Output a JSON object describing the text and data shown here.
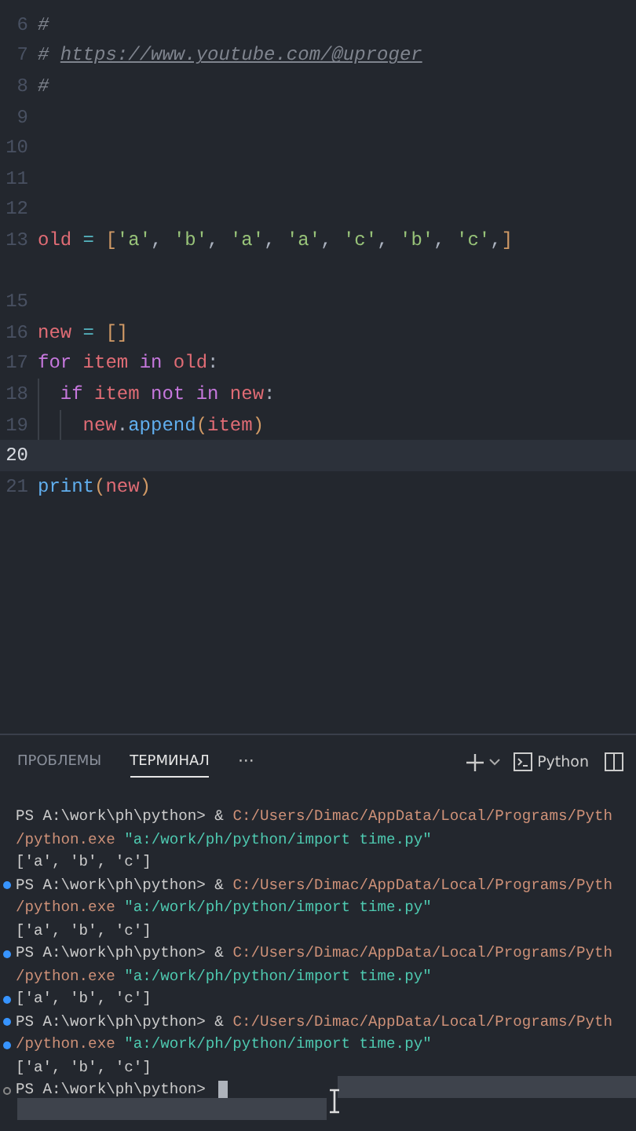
{
  "editor": {
    "lines": [
      {
        "number": "6",
        "current": false,
        "tokens": [
          {
            "kind": "comment",
            "text": "#"
          }
        ]
      },
      {
        "number": "7",
        "current": false,
        "tokens": [
          {
            "kind": "comment",
            "text": "# "
          },
          {
            "kind": "link",
            "text": "https://www.youtube.com/@uproger"
          }
        ]
      },
      {
        "number": "8",
        "current": false,
        "tokens": [
          {
            "kind": "comment",
            "text": "#"
          }
        ]
      },
      {
        "number": "9",
        "current": false
      },
      {
        "number": "10",
        "current": false
      },
      {
        "number": "11",
        "current": false
      },
      {
        "number": "12",
        "current": false
      },
      {
        "number": "13",
        "current": false,
        "tokens": [
          {
            "kind": "var",
            "text": "old"
          },
          {
            "kind": "op",
            "text": " = "
          },
          {
            "kind": "bracket",
            "text": "["
          },
          {
            "kind": "string",
            "text": "'a'"
          },
          {
            "kind": "punct",
            "text": ", "
          },
          {
            "kind": "string",
            "text": "'b'"
          },
          {
            "kind": "punct",
            "text": ", "
          },
          {
            "kind": "string",
            "text": "'a'"
          },
          {
            "kind": "punct",
            "text": ", "
          },
          {
            "kind": "string",
            "text": "'a'"
          },
          {
            "kind": "punct",
            "text": ", "
          },
          {
            "kind": "string",
            "text": "'c'"
          },
          {
            "kind": "punct",
            "text": ", "
          },
          {
            "kind": "string",
            "text": "'b'"
          },
          {
            "kind": "punct",
            "text": ", "
          },
          {
            "kind": "string",
            "text": "'c'"
          },
          {
            "kind": "punct",
            "text": ","
          },
          {
            "kind": "bracket",
            "text": "]"
          }
        ]
      },
      {
        "number": "15",
        "current": false,
        "gap_before": true
      },
      {
        "number": "16",
        "current": false,
        "tokens": [
          {
            "kind": "var",
            "text": "new"
          },
          {
            "kind": "op",
            "text": " = "
          },
          {
            "kind": "bracket",
            "text": "[]"
          }
        ]
      },
      {
        "number": "17",
        "current": false,
        "tokens": [
          {
            "kind": "keyword",
            "text": "for"
          },
          {
            "kind": "var",
            "text": " item "
          },
          {
            "kind": "keyword",
            "text": "in"
          },
          {
            "kind": "var",
            "text": " old"
          },
          {
            "kind": "punct",
            "text": ":"
          }
        ]
      },
      {
        "number": "18",
        "current": false,
        "tokens": [
          {
            "kind": "guide"
          },
          {
            "kind": "keyword",
            "text": "if"
          },
          {
            "kind": "var",
            "text": " item "
          },
          {
            "kind": "keyword",
            "text": "not in"
          },
          {
            "kind": "var",
            "text": " new"
          },
          {
            "kind": "punct",
            "text": ":"
          }
        ]
      },
      {
        "number": "19",
        "current": false,
        "tokens": [
          {
            "kind": "guide"
          },
          {
            "kind": "guide"
          },
          {
            "kind": "var",
            "text": "new"
          },
          {
            "kind": "punct",
            "text": "."
          },
          {
            "kind": "func",
            "text": "append"
          },
          {
            "kind": "bracket",
            "text": "("
          },
          {
            "kind": "var",
            "text": "item"
          },
          {
            "kind": "bracket",
            "text": ")"
          }
        ]
      },
      {
        "number": "20",
        "current": true
      },
      {
        "number": "21",
        "current": false,
        "tokens": [
          {
            "kind": "func",
            "text": "print"
          },
          {
            "kind": "bracket",
            "text": "("
          },
          {
            "kind": "var",
            "text": "new"
          },
          {
            "kind": "bracket",
            "text": ")"
          }
        ]
      }
    ]
  },
  "panel": {
    "tabs": [
      {
        "label": "ПРОБЛЕМЫ",
        "selected": false
      },
      {
        "label": "ТЕРМИНАЛ",
        "selected": true
      }
    ],
    "more": "···",
    "shell": "Python",
    "terminal": [
      {
        "segments": [
          {
            "kind": "plain",
            "text": "PS A:\\work\\ph\\python> & "
          },
          {
            "kind": "path",
            "text": "C:/Users/Dimac/AppData/Local/Programs/Pyth"
          }
        ]
      },
      {
        "segments": [
          {
            "kind": "path",
            "text": "/python.exe "
          },
          {
            "kind": "quoted",
            "text": "\"a:/work/ph/python/import time.py\""
          }
        ]
      },
      {
        "segments": [
          {
            "kind": "plain",
            "text": "['a', 'b', 'c']"
          }
        ]
      },
      {
        "finished": true,
        "segments": [
          {
            "kind": "plain",
            "text": "PS A:\\work\\ph\\python> & "
          },
          {
            "kind": "path",
            "text": "C:/Users/Dimac/AppData/Local/Programs/Pyth"
          }
        ]
      },
      {
        "segments": [
          {
            "kind": "path",
            "text": "/python.exe "
          },
          {
            "kind": "quoted",
            "text": "\"a:/work/ph/python/import time.py\""
          }
        ]
      },
      {
        "segments": [
          {
            "kind": "plain",
            "text": "['a', 'b', 'c']"
          }
        ]
      },
      {
        "finished": true,
        "segments": [
          {
            "kind": "plain",
            "text": "PS A:\\work\\ph\\python> & "
          },
          {
            "kind": "path",
            "text": "C:/Users/Dimac/AppData/Local/Programs/Pyth"
          }
        ]
      },
      {
        "segments": [
          {
            "kind": "path",
            "text": "/python.exe "
          },
          {
            "kind": "quoted",
            "text": "\"a:/work/ph/python/import time.py\""
          }
        ]
      },
      {
        "finished": true,
        "segments": [
          {
            "kind": "plain",
            "text": "['a', 'b', 'c']"
          }
        ]
      },
      {
        "finished": true,
        "segments": [
          {
            "kind": "plain",
            "text": "PS A:\\work\\ph\\python> & "
          },
          {
            "kind": "path",
            "text": "C:/Users/Dimac/AppData/Local/Programs/Pyth"
          }
        ]
      },
      {
        "finished": true,
        "segments": [
          {
            "kind": "path",
            "text": "/python.exe "
          },
          {
            "kind": "quoted",
            "text": "\"a:/work/ph/python/import time.py\""
          }
        ]
      },
      {
        "segments": [
          {
            "kind": "plain",
            "text": "['a', 'b', 'c']"
          }
        ]
      },
      {
        "finished": false,
        "cursor": true,
        "segments": [
          {
            "kind": "plain",
            "text": "PS A:\\work\\ph\\python> "
          }
        ]
      }
    ]
  }
}
